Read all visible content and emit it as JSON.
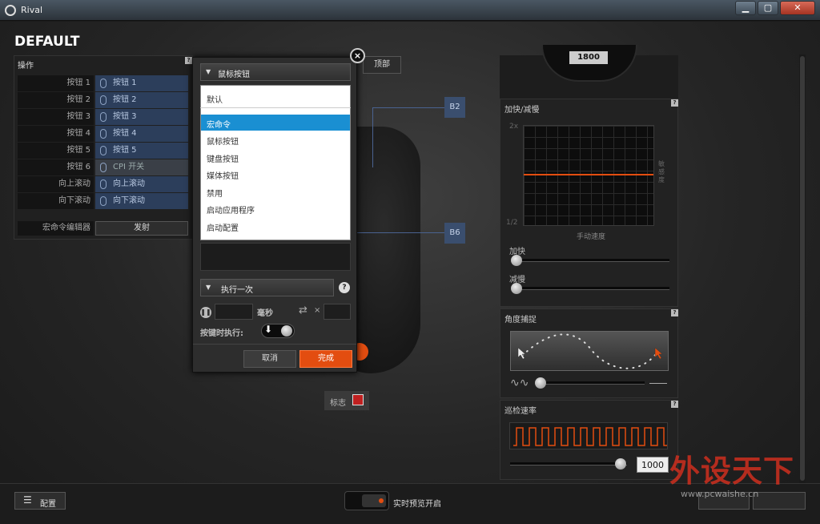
{
  "window": {
    "title": "Rival",
    "min": "▁",
    "max": "▢",
    "close": "✕"
  },
  "profile_name": "DEFAULT",
  "actions": {
    "header": "操作",
    "help": "?",
    "rows": [
      {
        "key": "按钮 1",
        "value": "按钮 1"
      },
      {
        "key": "按钮 2",
        "value": "按钮 2"
      },
      {
        "key": "按钮 3",
        "value": "按钮 3"
      },
      {
        "key": "按钮 4",
        "value": "按钮 4"
      },
      {
        "key": "按钮 5",
        "value": "按钮 5"
      },
      {
        "key": "按钮 6",
        "value": "CPI 开关"
      },
      {
        "key": "向上滚动",
        "value": "向上滚动"
      },
      {
        "key": "向下滚动",
        "value": "向下滚动"
      }
    ],
    "macro_editor_label": "宏命令编辑器",
    "macro_editor_button": "发射"
  },
  "top_button": "顶部",
  "nodes": {
    "b2": "B2",
    "b6": "B6"
  },
  "logo_label": "标志",
  "popup": {
    "header": "鼠标按钮",
    "options": [
      "默认",
      "宏命令",
      "鼠标按钮",
      "键盘按钮",
      "媒体按钮",
      "禁用",
      "启动应用程序",
      "启动配置"
    ],
    "selected": "宏命令",
    "execute": "执行一次",
    "help": "?",
    "ms_label": "毫秒",
    "repeat_x": "×",
    "hold_label": "按键时执行:",
    "cancel": "取消",
    "ok": "完成"
  },
  "right": {
    "cpi_value": "1800",
    "accel_header": "加快/减慢",
    "accel_y_top": "2x",
    "accel_y_bottom": "1/2",
    "accel_x_label": "手动速度",
    "accel_side": "敏感度",
    "accel_label": "加快",
    "decel_label": "减慢",
    "angle_header": "角度捕捉",
    "polling_header": "巡检速率",
    "polling_value": "1000",
    "help": "?"
  },
  "footer": {
    "config_button": "配置",
    "live_preview": "实时预览开启"
  },
  "watermark": {
    "brand": "外设天下",
    "url": "www.pcwaishe.cn"
  },
  "colors": {
    "accent": "#e34d10",
    "selection": "#1a8fd2",
    "binding": "#2c3e5b"
  }
}
